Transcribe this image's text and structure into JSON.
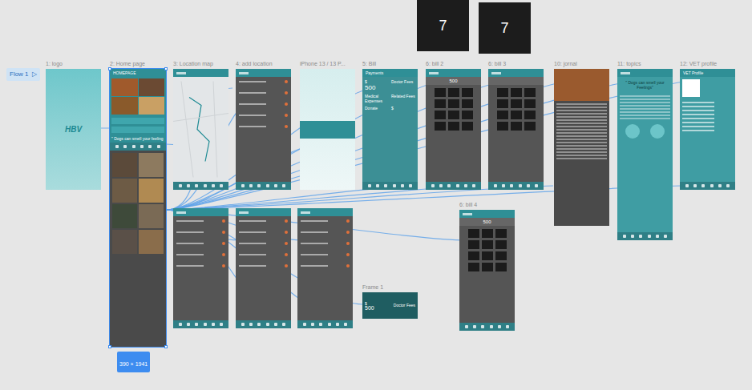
{
  "canvas_badges": [
    "7",
    "7"
  ],
  "flow": {
    "label": "Flow 1",
    "icon": "▷"
  },
  "frames": [
    {
      "label": "1: logo",
      "kind": "logo",
      "selected": false,
      "texts": [
        "HBV"
      ]
    },
    {
      "label": "2: Home page",
      "kind": "home",
      "selected": true,
      "texts": [
        "HOMEPAGE",
        "\" Dogs can smell your feeling"
      ]
    },
    {
      "label": "3: Location map",
      "kind": "map",
      "selected": false,
      "texts": []
    },
    {
      "label": "4: add location",
      "kind": "list",
      "selected": false,
      "texts": []
    },
    {
      "label": "iPhone 13 / 13 P...",
      "kind": "blank",
      "selected": false,
      "texts": []
    },
    {
      "label": "5: Bill",
      "kind": "bill",
      "selected": false,
      "texts": [
        "Payments",
        "$",
        "500",
        "Doctor Fees",
        "Medical Expenses",
        "Related Fees",
        "Donate",
        "$"
      ]
    },
    {
      "label": "6: bill 2",
      "kind": "keypad",
      "selected": false,
      "texts": [
        "500"
      ]
    },
    {
      "label": "6: bill 3",
      "kind": "keypad",
      "selected": false,
      "texts": []
    },
    {
      "label": "10: jornal",
      "kind": "journal",
      "selected": false,
      "texts": []
    },
    {
      "label": "11: topics",
      "kind": "topics",
      "selected": false,
      "texts": [
        "\" Dogs can smell your Feelings\""
      ]
    },
    {
      "label": "12: VET profile",
      "kind": "vet",
      "selected": false,
      "texts": [
        "VET Profile"
      ]
    },
    {
      "label": "",
      "kind": "list",
      "selected": false,
      "texts": []
    },
    {
      "label": "",
      "kind": "list",
      "selected": false,
      "texts": []
    },
    {
      "label": "",
      "kind": "list",
      "selected": false,
      "texts": []
    },
    {
      "label": "6: bill 4",
      "kind": "keypad",
      "selected": false,
      "texts": [
        "500"
      ]
    },
    {
      "label": "Frame 1",
      "kind": "chip",
      "selected": false,
      "texts": [
        "$",
        "500",
        "Doctor Fees"
      ]
    }
  ],
  "size_badge": "390 × 1941"
}
